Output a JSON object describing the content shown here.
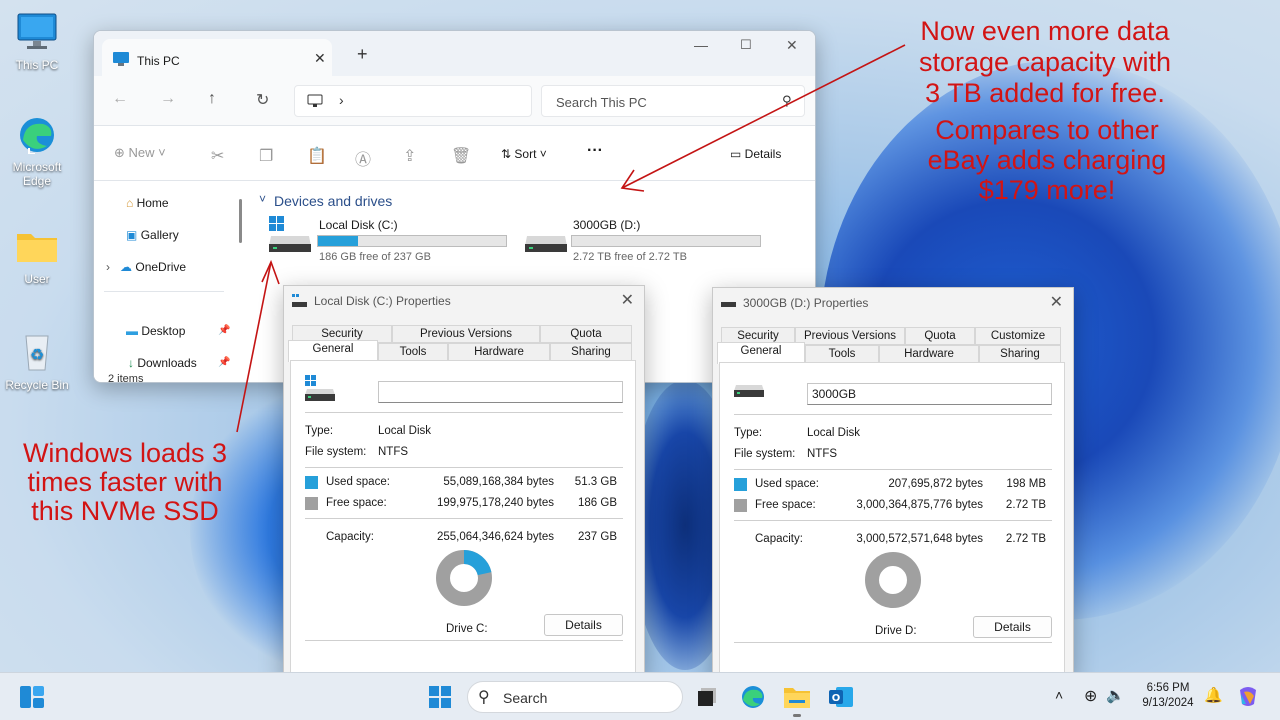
{
  "desktop": {
    "icons": [
      {
        "label": "This PC"
      },
      {
        "label": "Microsoft Edge"
      },
      {
        "label": "User"
      },
      {
        "label": "Recycle Bin"
      }
    ]
  },
  "explorer": {
    "tab_title": "This PC",
    "search_placeholder": "Search This PC",
    "cmd": {
      "new": "New",
      "sort": "Sort",
      "details": "Details"
    },
    "sidebar": [
      {
        "label": "Home"
      },
      {
        "label": "Gallery"
      },
      {
        "label": "OneDrive"
      },
      {
        "label": "Desktop"
      },
      {
        "label": "Downloads"
      }
    ],
    "status": "2 items",
    "section": "Devices and drives",
    "drives": [
      {
        "name": "Local Disk (C:)",
        "free": "186 GB free of 237 GB",
        "used_fraction": 0.215
      },
      {
        "name": "3000GB (D:)",
        "free": "2.72 TB free of 2.72 TB",
        "used_fraction": 0.0
      }
    ]
  },
  "dialog_c": {
    "title": "Local Disk (C:) Properties",
    "tabs_top": [
      "Security",
      "Previous Versions",
      "Quota"
    ],
    "tabs_bottom": [
      "General",
      "Tools",
      "Hardware",
      "Sharing"
    ],
    "name_value": "",
    "type_label": "Type:",
    "type_value": "Local Disk",
    "fs_label": "File system:",
    "fs_value": "NTFS",
    "used_label": "Used space:",
    "used_bytes": "55,089,168,384 bytes",
    "used_size": "51.3 GB",
    "free_label": "Free space:",
    "free_bytes": "199,975,178,240 bytes",
    "free_size": "186 GB",
    "cap_label": "Capacity:",
    "cap_bytes": "255,064,346,624 bytes",
    "cap_size": "237 GB",
    "drive_label": "Drive C:",
    "details_btn": "Details",
    "used_fraction": 0.216
  },
  "dialog_d": {
    "title": "3000GB (D:) Properties",
    "tabs_top": [
      "Security",
      "Previous Versions",
      "Quota",
      "Customize"
    ],
    "tabs_bottom": [
      "General",
      "Tools",
      "Hardware",
      "Sharing"
    ],
    "name_value": "3000GB",
    "type_label": "Type:",
    "type_value": "Local Disk",
    "fs_label": "File system:",
    "fs_value": "NTFS",
    "used_label": "Used space:",
    "used_bytes": "207,695,872 bytes",
    "used_size": "198 MB",
    "free_label": "Free space:",
    "free_bytes": "3,000,364,875,776 bytes",
    "free_size": "2.72 TB",
    "cap_label": "Capacity:",
    "cap_bytes": "3,000,572,571,648 bytes",
    "cap_size": "2.72 TB",
    "drive_label": "Drive D:",
    "details_btn": "Details",
    "used_fraction": 0.0
  },
  "callouts": {
    "top_lines": [
      "Now even more data",
      "storage capacity with",
      "3 TB added for free."
    ],
    "mid_lines": [
      "Compares to other",
      "eBay adds charging",
      "$179 more!"
    ],
    "left_lines": [
      "Windows loads 3",
      "times faster with",
      "this NVMe SSD"
    ]
  },
  "taskbar": {
    "search_label": "Search",
    "time": "6:56 PM",
    "date": "9/13/2024"
  },
  "colors": {
    "accent": "#26a0da",
    "free_gray": "#a0a0a0",
    "callout_red": "#d21414"
  }
}
